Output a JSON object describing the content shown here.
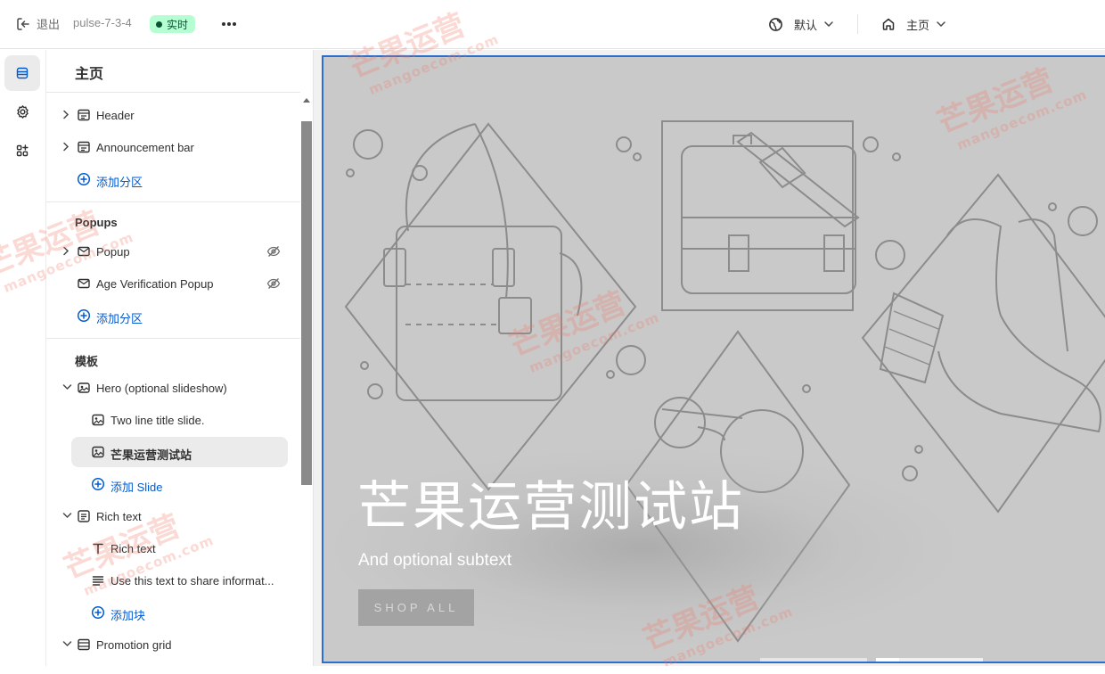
{
  "topbar": {
    "exit_label": "退出",
    "theme_name": "pulse-7-3-4",
    "live_badge": "实时",
    "language_select": "默认",
    "page_select": "主页"
  },
  "sidebar": {
    "title": "主页",
    "header_sections": [
      {
        "label": "Header"
      },
      {
        "label": "Announcement bar"
      }
    ],
    "add_section_label": "添加分区",
    "popups_heading": "Popups",
    "popups": [
      {
        "label": "Popup"
      },
      {
        "label": "Age Verification Popup"
      }
    ],
    "template_heading": "模板",
    "template_items": [
      {
        "label": "Hero (optional slideshow)"
      },
      {
        "label": "Two line title slide."
      },
      {
        "label": "芒果运营测试站"
      },
      {
        "label": "添加 Slide"
      },
      {
        "label": "Rich text"
      },
      {
        "label": "Rich text"
      },
      {
        "label": "Use this text to share informat..."
      },
      {
        "label": "添加块"
      },
      {
        "label": "Promotion grid"
      }
    ]
  },
  "hero": {
    "title": "芒果运营测试站",
    "subtitle": "And optional subtext",
    "button_label": "SHOP ALL"
  },
  "watermark": {
    "text": "芒果运营",
    "url": "mangoecom.com"
  },
  "colors": {
    "accent_blue": "#005bd3",
    "live_badge_bg": "#b4fed2",
    "hero_bg": "#c9c9c9",
    "selection_outline": "#2c6ecb"
  }
}
